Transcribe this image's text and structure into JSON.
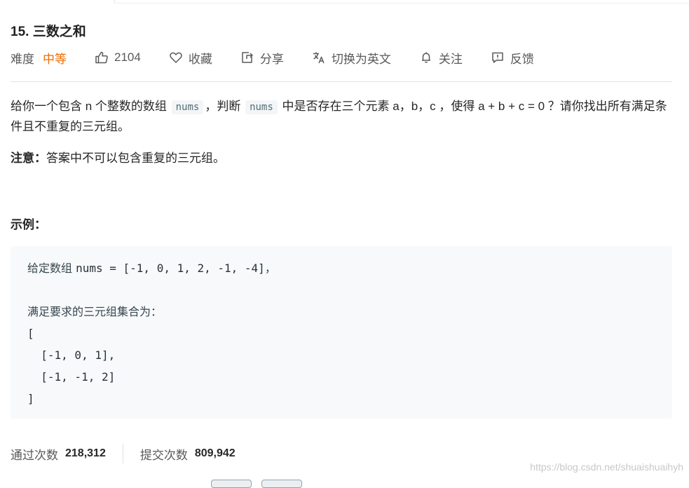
{
  "problem": {
    "title": "15. 三数之和",
    "difficulty_label": "难度",
    "difficulty_value": "中等",
    "likes": "2104",
    "favorite_label": "收藏",
    "share_label": "分享",
    "translate_label": "切换为英文",
    "follow_label": "关注",
    "feedback_label": "反馈"
  },
  "description": {
    "part1": "给你一个包含 n 个整数的数组 ",
    "code1": "nums",
    "part2": "，判断 ",
    "code2": "nums",
    "part3": " 中是否存在三个元素 a，b，c ，使得 a + b + c = 0 ？请你找出所有满足条件且不重复的三元组。"
  },
  "note": {
    "label": "注意：",
    "text": "答案中不可以包含重复的三元组。"
  },
  "example": {
    "title": "示例：",
    "line1_cjk": "给定数组 ",
    "line1_code": "nums = [-1, 0, 1, 2, -1, -4]",
    "line1_end": "，",
    "line3": "满足要求的三元组集合为：",
    "line4": "[",
    "line5": "  [-1, 0, 1],",
    "line6": "  [-1, -1, 2]",
    "line7": "]"
  },
  "stats": {
    "accepted_label": "通过次数",
    "accepted_value": "218,312",
    "submitted_label": "提交次数",
    "submitted_value": "809,942"
  },
  "watermark": "https://blog.csdn.net/shuaishuaihyh",
  "colors": {
    "difficulty_medium": "#ef6c00",
    "code_bg": "#f7f9fa"
  },
  "icons": {
    "like": "thumbs-up-icon",
    "favorite": "heart-icon",
    "share": "share-icon",
    "translate": "translate-icon",
    "follow": "bell-icon",
    "feedback": "feedback-icon"
  }
}
